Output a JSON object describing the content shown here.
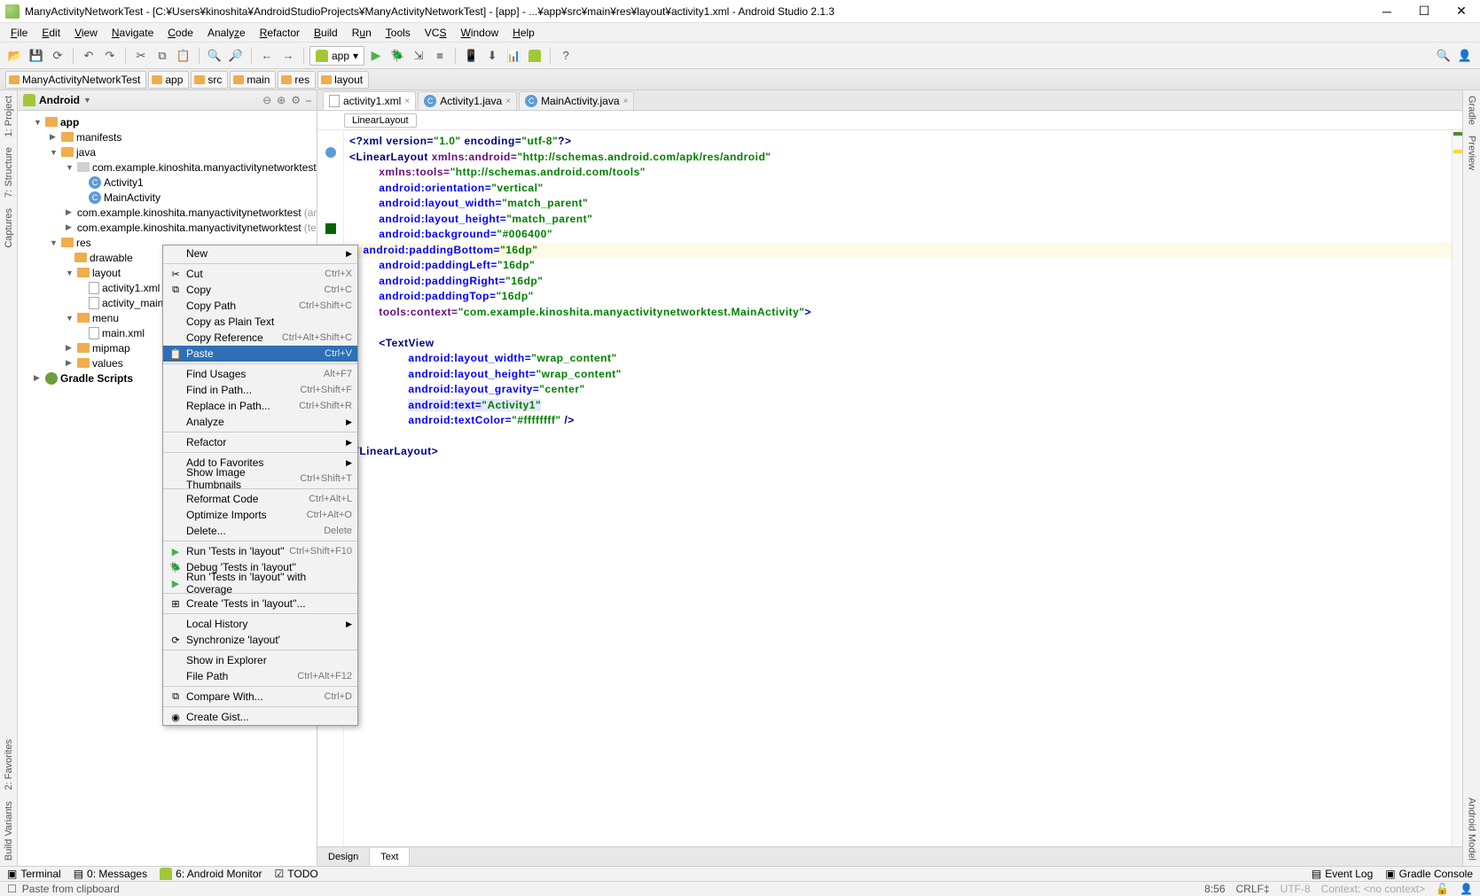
{
  "title": "ManyActivityNetworkTest - [C:¥Users¥kinoshita¥AndroidStudioProjects¥ManyActivityNetworkTest] - [app] - ...¥app¥src¥main¥res¥layout¥activity1.xml - Android Studio 2.1.3",
  "menubar": [
    "File",
    "Edit",
    "View",
    "Navigate",
    "Code",
    "Analyze",
    "Refactor",
    "Build",
    "Run",
    "Tools",
    "VCS",
    "Window",
    "Help"
  ],
  "toolbar": {
    "run_config": "app"
  },
  "breadcrumb": [
    "ManyActivityNetworkTest",
    "app",
    "src",
    "main",
    "res",
    "layout"
  ],
  "project_panel": {
    "header": "Android",
    "tree": {
      "app": "app",
      "manifests": "manifests",
      "java": "java",
      "pkg_main": "com.example.kinoshita.manyactivitynetworktest",
      "class1": "Activity1",
      "class2": "MainActivity",
      "pkg_android_test": "com.example.kinoshita.manyactivitynetworktest",
      "pkg_android_test_suffix": " (androidTest)",
      "pkg_test": "com.example.kinoshita.manyactivitynetworktest",
      "pkg_test_suffix": " (test)",
      "res": "res",
      "drawable": "drawable",
      "layout": "layout",
      "activity1_xml": "activity1.xml",
      "activity_main_xml": "activity_main.xml",
      "menu": "menu",
      "main_xml": "main.xml",
      "mipmap": "mipmap",
      "values": "values",
      "gradle": "Gradle Scripts"
    }
  },
  "editor": {
    "tabs": [
      {
        "label": "activity1.xml",
        "active": true
      },
      {
        "label": "Activity1.java",
        "active": false
      },
      {
        "label": "MainActivity.java",
        "active": false
      }
    ],
    "crumb": "LinearLayout",
    "footer_tabs": {
      "design": "Design",
      "text": "Text"
    },
    "code": {
      "l1a": "<?xml version=",
      "l1b": "\"1.0\"",
      "l1c": " encoding=",
      "l1d": "\"utf-8\"",
      "l1e": "?>",
      "l2a": "<LinearLayout ",
      "l2b": "xmlns:android=",
      "l2c": "\"http://schemas.android.com/apk/res/android\"",
      "l3a": "xmlns:tools=",
      "l3b": "\"http://schemas.android.com/tools\"",
      "l4a": "android:orientation=",
      "l4b": "\"vertical\"",
      "l5a": "android:layout_width=",
      "l5b": "\"match_parent\"",
      "l6a": "android:layout_height=",
      "l6b": "\"match_parent\"",
      "l7a": "android:background=",
      "l7b": "\"#006400\"",
      "l8a": "android:paddingBottom=",
      "l8b": "\"16dp\"",
      "l9a": "android:paddingLeft=",
      "l9b": "\"16dp\"",
      "l10a": "android:paddingRight=",
      "l10b": "\"16dp\"",
      "l11a": "android:paddingTop=",
      "l11b": "\"16dp\"",
      "l12a": "tools:context=",
      "l12b": "\"com.example.kinoshita.manyactivitynetworktest.MainActivity\"",
      "l12c": ">",
      "l13": "<TextView",
      "l14a": "android:layout_width=",
      "l14b": "\"wrap_content\"",
      "l15a": "android:layout_height=",
      "l15b": "\"wrap_content\"",
      "l16a": "android:layout_gravity=",
      "l16b": "\"center\"",
      "l17a": "android:text=",
      "l17b": "\"Activity1\"",
      "l18a": "android:textColor=",
      "l18b": "\"#ffffffff\"",
      "l18c": " />",
      "l19": "</LinearLayout>"
    }
  },
  "context_menu": {
    "new": "New",
    "cut": "Cut",
    "cut_k": "Ctrl+X",
    "copy": "Copy",
    "copy_k": "Ctrl+C",
    "copy_path": "Copy Path",
    "copy_path_k": "Ctrl+Shift+C",
    "copy_plain": "Copy as Plain Text",
    "copy_ref": "Copy Reference",
    "copy_ref_k": "Ctrl+Alt+Shift+C",
    "paste": "Paste",
    "paste_k": "Ctrl+V",
    "find_usages": "Find Usages",
    "find_usages_k": "Alt+F7",
    "find_in_path": "Find in Path...",
    "find_in_path_k": "Ctrl+Shift+F",
    "replace_in_path": "Replace in Path...",
    "replace_in_path_k": "Ctrl+Shift+R",
    "analyze": "Analyze",
    "refactor": "Refactor",
    "add_fav": "Add to Favorites",
    "show_thumbs": "Show Image Thumbnails",
    "show_thumbs_k": "Ctrl+Shift+T",
    "reformat": "Reformat Code",
    "reformat_k": "Ctrl+Alt+L",
    "optimize": "Optimize Imports",
    "optimize_k": "Ctrl+Alt+O",
    "delete": "Delete...",
    "delete_k": "Delete",
    "run_tests": "Run 'Tests in 'layout''",
    "run_tests_k": "Ctrl+Shift+F10",
    "debug_tests": "Debug 'Tests in 'layout''",
    "coverage": "Run 'Tests in 'layout'' with Coverage",
    "create_tests": "Create 'Tests in 'layout''...",
    "local_history": "Local History",
    "sync": "Synchronize 'layout'",
    "explorer": "Show in Explorer",
    "file_path": "File Path",
    "file_path_k": "Ctrl+Alt+F12",
    "compare": "Compare With...",
    "compare_k": "Ctrl+D",
    "gist": "Create Gist..."
  },
  "side_left": [
    "1: Project",
    "7: Structure",
    "Captures"
  ],
  "side_left_bottom": [
    "Build Variants",
    "2: Favorites"
  ],
  "side_right": [
    "Gradle",
    "Preview"
  ],
  "side_right_bottom": [
    "Android Model"
  ],
  "bottom": {
    "terminal": "Terminal",
    "messages": "0: Messages",
    "monitor": "6: Android Monitor",
    "todo": "TODO",
    "event_log": "Event Log",
    "gradle_console": "Gradle Console"
  },
  "status": {
    "msg": "Paste from clipboard",
    "pos": "8:56",
    "line_sep": "CRLF",
    "encoding": "UTF-8",
    "context": "Context: <no context>"
  }
}
